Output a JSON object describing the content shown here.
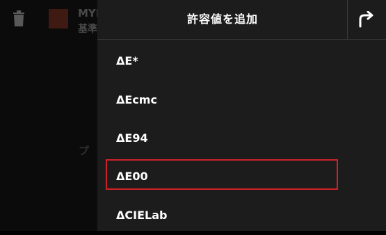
{
  "background": {
    "item_name": "MYL",
    "item_sub": "基準",
    "middle_text": "プ"
  },
  "panel": {
    "title": "許容値を追加",
    "items": [
      {
        "label": "ΔE*"
      },
      {
        "label": "ΔEcmc"
      },
      {
        "label": "ΔE94"
      },
      {
        "label": "ΔE00"
      },
      {
        "label": "ΔCIELab"
      }
    ],
    "highlighted_index": 3
  },
  "icons": {
    "redo": "redo-arrow-icon",
    "trash": "trash-icon"
  },
  "colors": {
    "panel_bg": "#1c1c1c",
    "highlight_border": "#d0202a",
    "text": "#ffffff"
  }
}
